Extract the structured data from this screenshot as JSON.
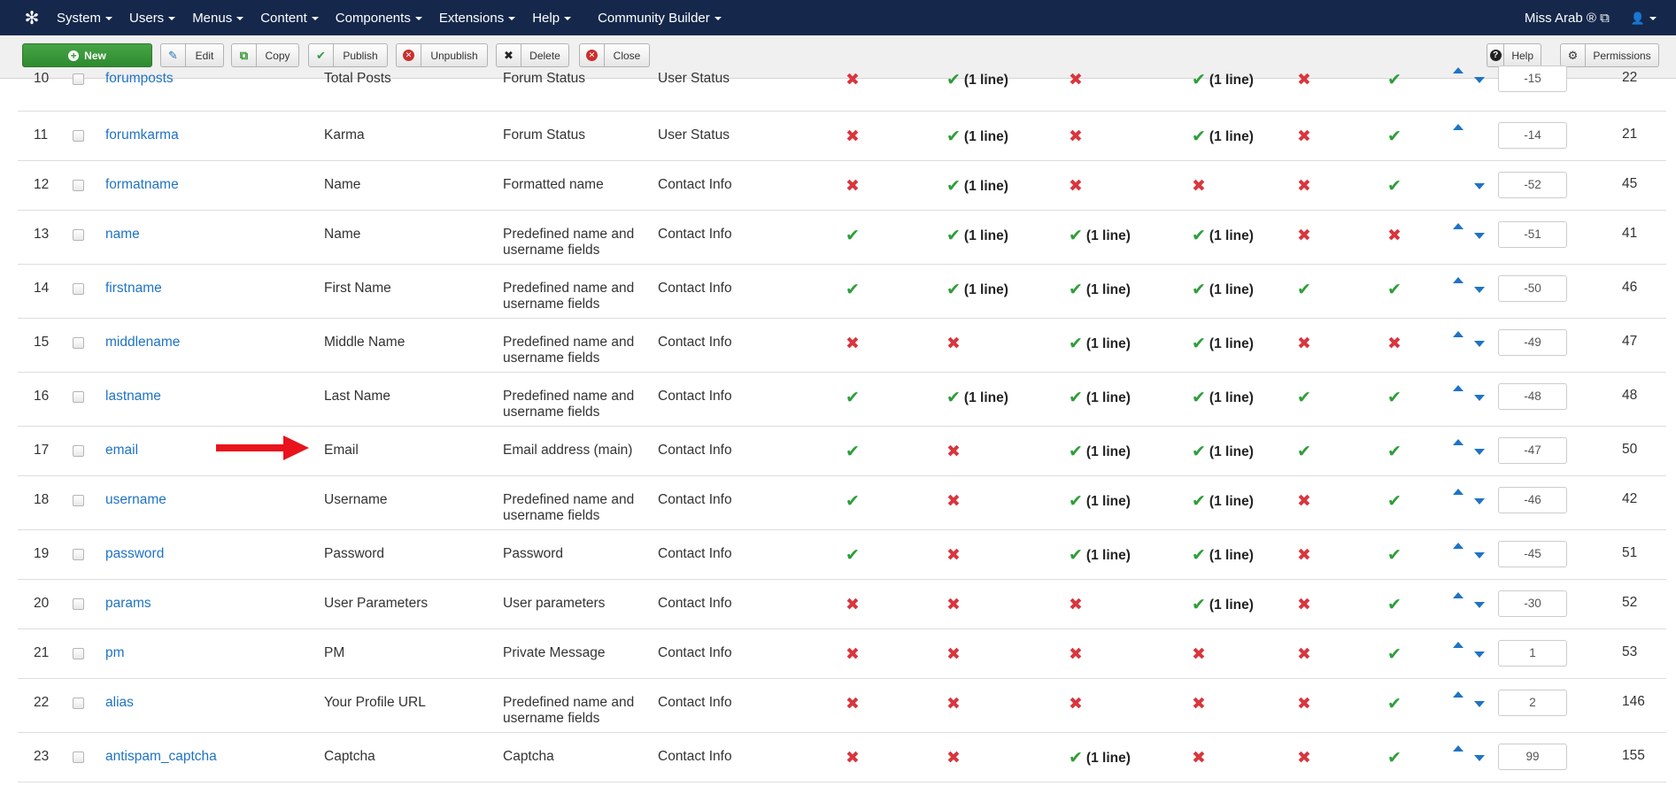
{
  "navbar": {
    "logo_icon": "joomla-logo-icon",
    "menu": [
      "System",
      "Users",
      "Menus",
      "Content",
      "Components",
      "Extensions",
      "Help",
      "Community Builder"
    ],
    "user_name": "Miss Arab",
    "user_icon": "user-icon"
  },
  "toolbar": {
    "new_label": "New",
    "edit_label": "Edit",
    "copy_label": "Copy",
    "publish_label": "Publish",
    "unpublish_label": "Unpublish",
    "delete_label": "Delete",
    "close_label": "Close",
    "help_label": "Help",
    "permissions_label": "Permissions"
  },
  "colors": {
    "navbar_bg": "#15284b",
    "new_button": "#46a546",
    "link": "#1f73c4",
    "check": "#2e9e3a",
    "cross": "#d9363e"
  },
  "line_label": "(1 line)",
  "rows": [
    {
      "num": "10",
      "name": "forumposts",
      "title": "Total Posts",
      "desc": "Forum Status",
      "tab": "User Status",
      "m": [
        0,
        1,
        0,
        1,
        0,
        2
      ],
      "up": true,
      "down": true,
      "order": "-15",
      "id": "22"
    },
    {
      "num": "11",
      "name": "forumkarma",
      "title": "Karma",
      "desc": "Forum Status",
      "tab": "User Status",
      "m": [
        0,
        1,
        0,
        1,
        0,
        2
      ],
      "up": true,
      "down": false,
      "order": "-14",
      "id": "21"
    },
    {
      "num": "12",
      "name": "formatname",
      "title": "Name",
      "desc": "Formatted name",
      "tab": "Contact Info",
      "m": [
        0,
        1,
        0,
        0,
        0,
        2
      ],
      "up": false,
      "down": true,
      "order": "-52",
      "id": "45"
    },
    {
      "num": "13",
      "name": "name",
      "title": "Name",
      "desc": "Predefined name and username fields",
      "tab": "Contact Info",
      "m": [
        2,
        1,
        1,
        1,
        0,
        0
      ],
      "up": true,
      "down": true,
      "order": "-51",
      "id": "41"
    },
    {
      "num": "14",
      "name": "firstname",
      "title": "First Name",
      "desc": "Predefined name and username fields",
      "tab": "Contact Info",
      "m": [
        2,
        1,
        1,
        1,
        2,
        2
      ],
      "up": true,
      "down": true,
      "order": "-50",
      "id": "46"
    },
    {
      "num": "15",
      "name": "middlename",
      "title": "Middle Name",
      "desc": "Predefined name and username fields",
      "tab": "Contact Info",
      "m": [
        0,
        0,
        1,
        1,
        0,
        0
      ],
      "up": true,
      "down": true,
      "order": "-49",
      "id": "47"
    },
    {
      "num": "16",
      "name": "lastname",
      "title": "Last Name",
      "desc": "Predefined name and username fields",
      "tab": "Contact Info",
      "m": [
        2,
        1,
        1,
        1,
        2,
        2
      ],
      "up": true,
      "down": true,
      "order": "-48",
      "id": "48"
    },
    {
      "num": "17",
      "name": "email",
      "title": "Email",
      "desc": "Email address (main)",
      "tab": "Contact Info",
      "m": [
        2,
        0,
        1,
        1,
        2,
        2
      ],
      "up": true,
      "down": true,
      "order": "-47",
      "id": "50"
    },
    {
      "num": "18",
      "name": "username",
      "title": "Username",
      "desc": "Predefined name and username fields",
      "tab": "Contact Info",
      "m": [
        2,
        0,
        1,
        1,
        0,
        2
      ],
      "up": true,
      "down": true,
      "order": "-46",
      "id": "42"
    },
    {
      "num": "19",
      "name": "password",
      "title": "Password",
      "desc": "Password",
      "tab": "Contact Info",
      "m": [
        2,
        0,
        1,
        1,
        0,
        2
      ],
      "up": true,
      "down": true,
      "order": "-45",
      "id": "51"
    },
    {
      "num": "20",
      "name": "params",
      "title": "User Parameters",
      "desc": "User parameters",
      "tab": "Contact Info",
      "m": [
        0,
        0,
        0,
        1,
        0,
        2
      ],
      "up": true,
      "down": true,
      "order": "-30",
      "id": "52"
    },
    {
      "num": "21",
      "name": "pm",
      "title": "PM",
      "desc": "Private Message",
      "tab": "Contact Info",
      "m": [
        0,
        0,
        0,
        0,
        0,
        2
      ],
      "up": true,
      "down": true,
      "order": "1",
      "id": "53"
    },
    {
      "num": "22",
      "name": "alias",
      "title": "Your Profile URL",
      "desc": "Predefined name and username fields",
      "tab": "Contact Info",
      "m": [
        0,
        0,
        0,
        0,
        0,
        2
      ],
      "up": true,
      "down": true,
      "order": "2",
      "id": "146"
    },
    {
      "num": "23",
      "name": "antispam_captcha",
      "title": "Captcha",
      "desc": "Captcha",
      "tab": "Contact Info",
      "m": [
        0,
        0,
        1,
        0,
        0,
        2
      ],
      "up": true,
      "down": true,
      "order": "99",
      "id": "155"
    }
  ]
}
